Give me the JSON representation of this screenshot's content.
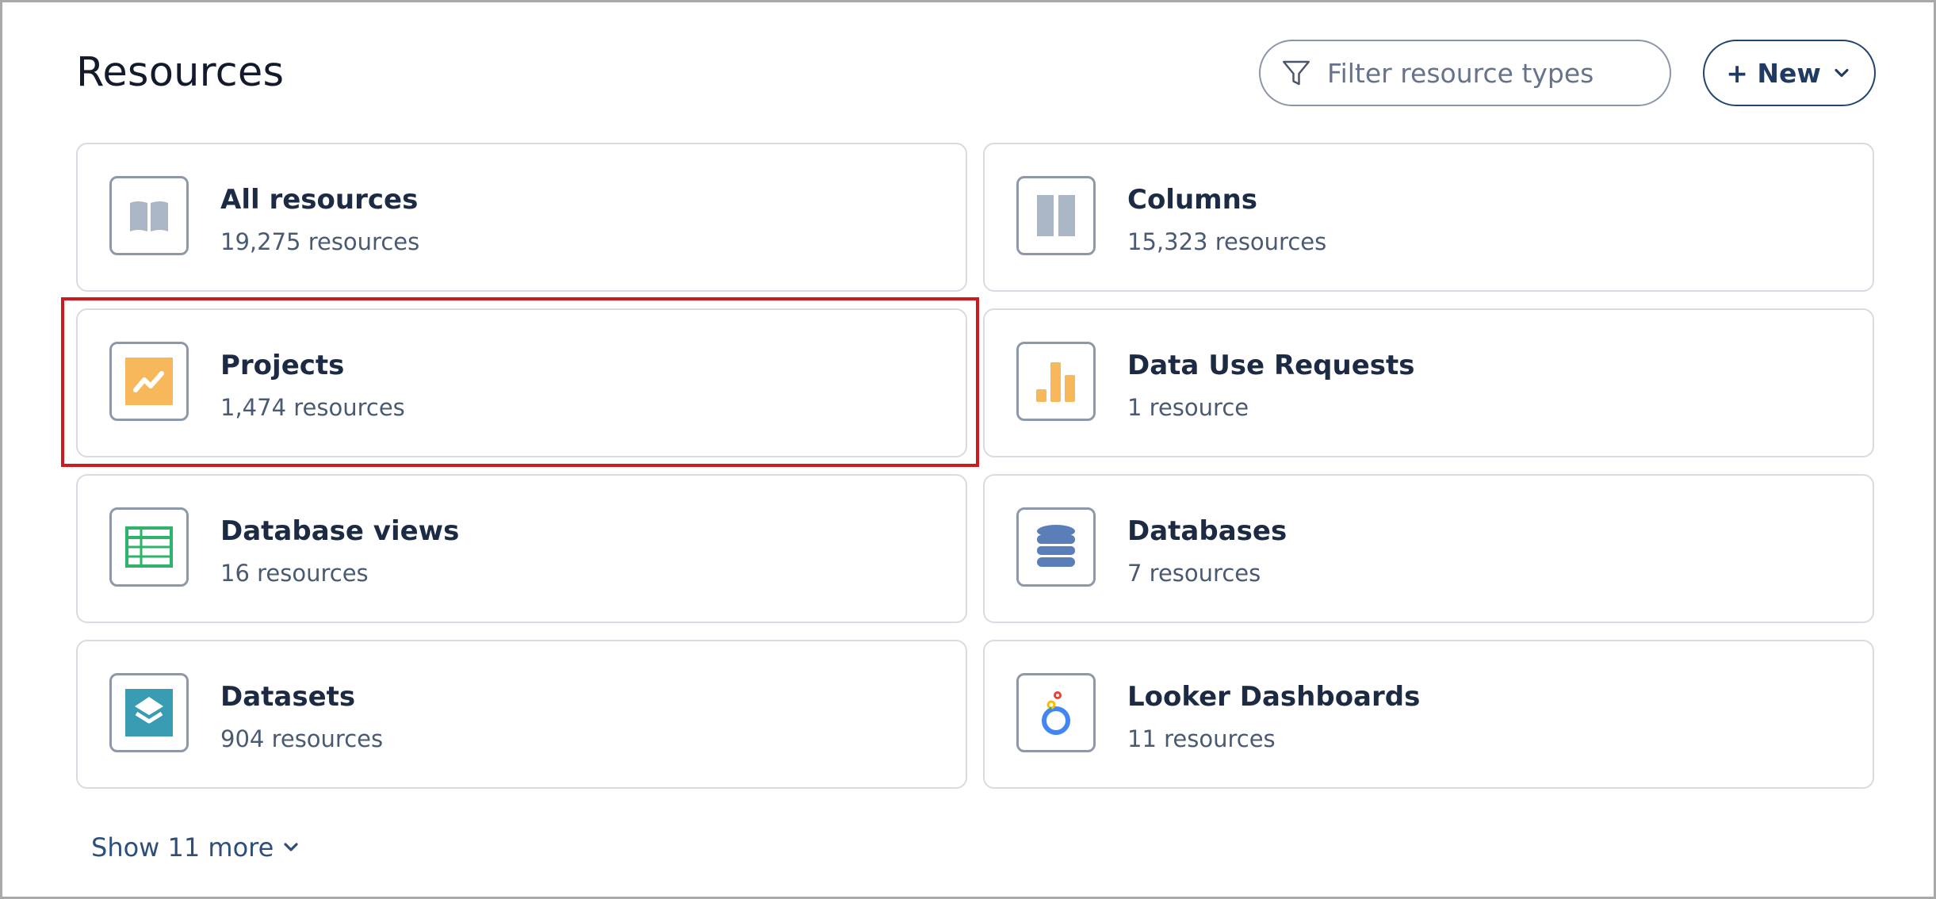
{
  "header": {
    "title": "Resources",
    "filter_placeholder": "Filter resource types",
    "new_button_label": "+ New"
  },
  "cards": [
    {
      "title": "All resources",
      "count": "19,275 resources",
      "icon": "book-icon"
    },
    {
      "title": "Columns",
      "count": "15,323 resources",
      "icon": "columns-icon"
    },
    {
      "title": "Projects",
      "count": "1,474 resources",
      "icon": "project-trend-icon"
    },
    {
      "title": "Data Use Requests",
      "count": "1 resource",
      "icon": "bar-chart-icon"
    },
    {
      "title": "Database views",
      "count": "16 resources",
      "icon": "table-grid-icon"
    },
    {
      "title": "Databases",
      "count": "7 resources",
      "icon": "database-icon"
    },
    {
      "title": "Datasets",
      "count": "904 resources",
      "icon": "layers-icon"
    },
    {
      "title": "Looker Dashboards",
      "count": "11 resources",
      "icon": "looker-icon"
    }
  ],
  "footer": {
    "show_more_label": "Show 11 more"
  },
  "colors": {
    "highlight": "#d0191f",
    "accent_orange": "#f6b85a",
    "green": "#2fb36a",
    "db_blue": "#5a7fb8",
    "dataset_teal": "#3a9cb3",
    "gray_icon": "#aab6c6"
  }
}
